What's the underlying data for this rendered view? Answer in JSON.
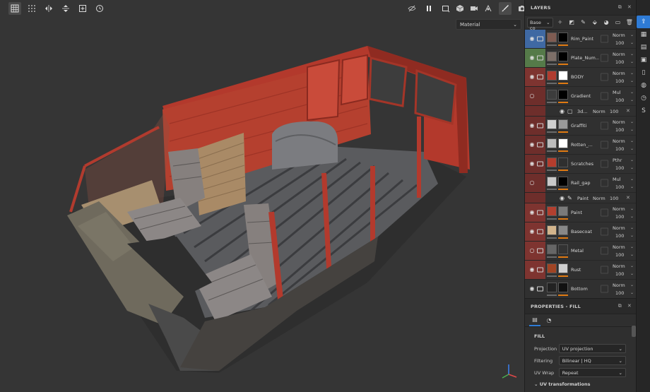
{
  "viewport": {
    "material_mode": "Material"
  },
  "layers_panel": {
    "title": "LAYERS",
    "channel": "Base co",
    "layers": [
      {
        "name": "Rim_Paint",
        "color": "#3f69a3",
        "blend": "Norm",
        "opacity": "100",
        "thumb1": "#7f5c52",
        "thumb2": "#000000",
        "visible": true,
        "folder": true
      },
      {
        "name": "Plate_Num...",
        "color": "#557a49",
        "blend": "Norm",
        "opacity": "100",
        "thumb1": "#7d6f68",
        "thumb2": "#000000",
        "visible": true,
        "folder": true
      },
      {
        "name": "BODY",
        "color": "#7e3430",
        "blend": "Norm",
        "opacity": "100",
        "thumb1": "#b03c30",
        "thumb2": "#ffffff",
        "visible": true,
        "folder": true
      },
      {
        "name": "Gradient",
        "color": "#6e2e2b",
        "blend": "Mul",
        "opacity": "100",
        "thumb1": "#3c3c3c",
        "thumb2": "#000000",
        "visible": false,
        "folder": false
      },
      {
        "name": "Graffiti",
        "color": "#6e2e2b",
        "blend": "Norm",
        "opacity": "100",
        "thumb1": "#cfcfcf",
        "thumb2": "#9a9a9a",
        "visible": true,
        "folder": true
      },
      {
        "name": "Rotten_...",
        "color": "#6e2e2b",
        "blend": "Norm",
        "opacity": "100",
        "thumb1": "#bdbdbd",
        "thumb2": "#ffffff",
        "visible": true,
        "folder": true
      },
      {
        "name": "Scratches",
        "color": "#6e2e2b",
        "blend": "Pthr",
        "opacity": "100",
        "thumb1": "#b43d2d",
        "thumb2": "#2f2f2f",
        "visible": true,
        "folder": true
      },
      {
        "name": "Rail_gap",
        "color": "#6e2e2b",
        "blend": "Mul",
        "opacity": "100",
        "thumb1": "#c9c9c9",
        "thumb2": "#000000",
        "visible": false,
        "folder": false
      },
      {
        "name": "Paint",
        "color": "#7e3430",
        "blend": "Norm",
        "opacity": "100",
        "thumb1": "#b3402f",
        "thumb2": "#7a7a7a",
        "visible": true,
        "folder": true
      },
      {
        "name": "Basecoat",
        "color": "#7e3430",
        "blend": "Norm",
        "opacity": "100",
        "thumb1": "#d2b48c",
        "thumb2": "#888888",
        "visible": true,
        "folder": true
      },
      {
        "name": "Metal",
        "color": "#7e3430",
        "blend": "Norm",
        "opacity": "100",
        "thumb1": "#666666",
        "thumb2": "#333333",
        "visible": false,
        "folder": true
      },
      {
        "name": "Rust",
        "color": "#7e3430",
        "blend": "Norm",
        "opacity": "100",
        "thumb1": "#a04424",
        "thumb2": "#cfcfcf",
        "visible": true,
        "folder": true
      },
      {
        "name": "Bottom",
        "color": "#303030",
        "blend": "Norm",
        "opacity": "100",
        "thumb1": "#222222",
        "thumb2": "#111111",
        "visible": true,
        "folder": true
      }
    ],
    "sublayers": [
      {
        "name": "3d...",
        "blend": "Norm",
        "opacity": "100",
        "after": 3
      },
      {
        "name": "Paint",
        "blend": "Norm",
        "opacity": "100",
        "after": 7
      }
    ]
  },
  "properties_panel": {
    "title": "PROPERTIES - FILL",
    "section": "FILL",
    "rows": [
      {
        "label": "Projection",
        "value": "UV projection"
      },
      {
        "label": "Filtering",
        "value": "Bilinear | HQ"
      },
      {
        "label": "UV Wrap",
        "value": "Repeat"
      }
    ],
    "uv_section": "UV transformations"
  }
}
